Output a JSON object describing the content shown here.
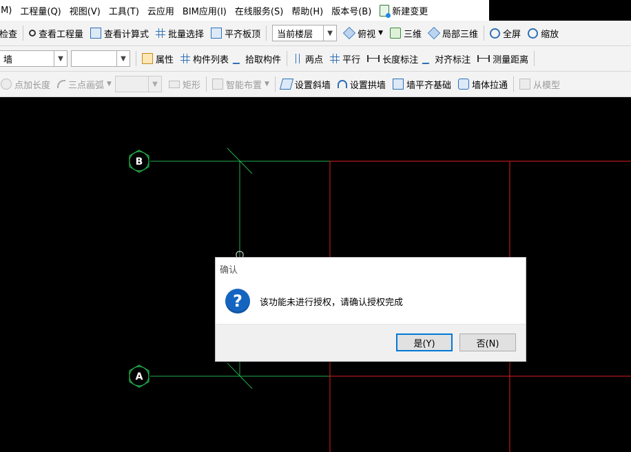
{
  "menubar": {
    "items": [
      "(M)",
      "工程量(Q)",
      "视图(V)",
      "工具(T)",
      "云应用",
      "BIM应用(I)",
      "在线服务(S)",
      "帮助(H)",
      "版本号(B)"
    ],
    "new_change": "新建变更"
  },
  "toolbar1": {
    "check": "检查",
    "view_quantity": "查看工程量",
    "view_formula": "查看计算式",
    "batch_select": "批量选择",
    "flush_slab_top": "平齐板顶",
    "floor_select": "当前楼层",
    "top_view": "俯视",
    "three_d": "三维",
    "partial_3d": "局部三维",
    "full_screen": "全屏",
    "zoom": "缩放"
  },
  "toolbar2": {
    "component_type": "墙",
    "component_name": "",
    "properties": "属性",
    "component_list": "构件列表",
    "pick_component": "拾取构件",
    "two_points": "两点",
    "parallel": "平行",
    "length_dim": "长度标注",
    "aligned_dim": "对齐标注",
    "measure_distance": "测量距离"
  },
  "toolbar3": {
    "add_length": "点加长度",
    "three_point_arc": "三点画弧",
    "rectangle": "矩形",
    "smart_layout": "智能布置",
    "set_sloped_wall": "设置斜墙",
    "set_arch_wall": "设置拱墙",
    "wall_flush_foundation": "墙平齐基础",
    "wall_stretch": "墙体拉通",
    "from_model": "从模型"
  },
  "canvas": {
    "axis_labels": [
      "B",
      "A"
    ],
    "colors": {
      "axis": "#22b14c",
      "wall": "#e01e1e",
      "background": "#000000"
    }
  },
  "dialog": {
    "title": "确认",
    "message": "该功能未进行授权，请确认授权完成",
    "yes_label": "是(Y)",
    "no_label": "否(N)"
  }
}
